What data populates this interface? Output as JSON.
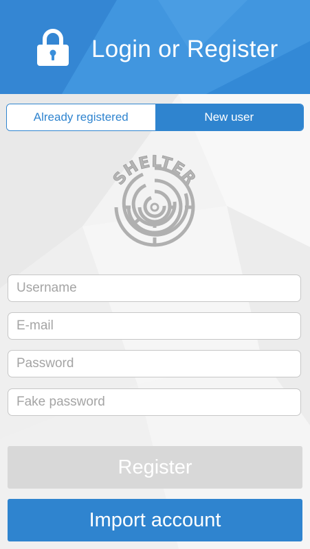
{
  "header": {
    "title": "Login or Register",
    "icon": "lock-icon",
    "background_color": "#3a8fdb"
  },
  "segment": {
    "options": [
      {
        "label": "Already registered",
        "active": false
      },
      {
        "label": "New user",
        "active": true
      }
    ],
    "accent_color": "#2f84cf"
  },
  "logo": {
    "text": "SHELTER",
    "icon": "maze-logo-icon"
  },
  "form": {
    "username": {
      "placeholder": "Username",
      "value": ""
    },
    "email": {
      "placeholder": "E-mail",
      "value": ""
    },
    "password": {
      "placeholder": "Password",
      "value": ""
    },
    "fake_password": {
      "placeholder": "Fake password",
      "value": ""
    }
  },
  "buttons": {
    "register": {
      "label": "Register",
      "enabled": false
    },
    "import_account": {
      "label": "Import account"
    }
  }
}
